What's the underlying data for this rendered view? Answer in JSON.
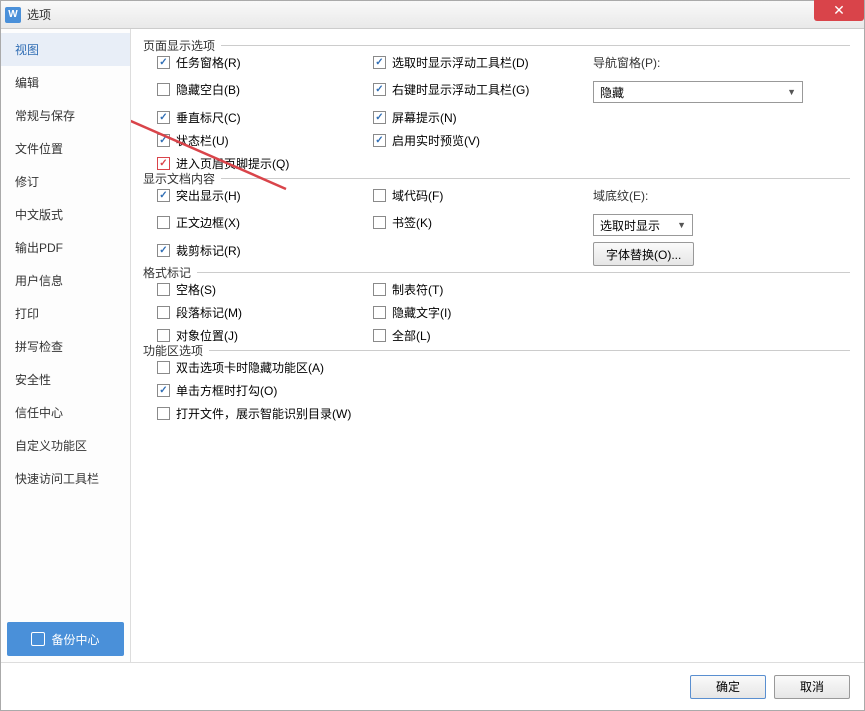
{
  "window": {
    "app_icon_letter": "W",
    "title": "选项",
    "close_glyph": "✕"
  },
  "sidebar": {
    "items": [
      {
        "label": "视图",
        "selected": true
      },
      {
        "label": "编辑"
      },
      {
        "label": "常规与保存"
      },
      {
        "label": "文件位置"
      },
      {
        "label": "修订"
      },
      {
        "label": "中文版式"
      },
      {
        "label": "输出PDF"
      },
      {
        "label": "用户信息"
      },
      {
        "label": "打印"
      },
      {
        "label": "拼写检查"
      },
      {
        "label": "安全性"
      },
      {
        "label": "信任中心"
      },
      {
        "label": "自定义功能区"
      },
      {
        "label": "快速访问工具栏"
      }
    ],
    "backup_label": "备份中心"
  },
  "sections": {
    "page_display": {
      "legend": "页面显示选项",
      "col1": [
        {
          "label": "任务窗格(R)",
          "checked": true
        },
        {
          "label": "隐藏空白(B)",
          "checked": false
        },
        {
          "label": "垂直标尺(C)",
          "checked": true
        },
        {
          "label": "状态栏(U)",
          "checked": true
        },
        {
          "label": "进入页眉页脚提示(Q)",
          "checked": true,
          "red": true
        }
      ],
      "col2": [
        {
          "label": "选取时显示浮动工具栏(D)",
          "checked": true
        },
        {
          "label": "右键时显示浮动工具栏(G)",
          "checked": true
        },
        {
          "label": "屏幕提示(N)",
          "checked": true
        },
        {
          "label": "启用实时预览(V)",
          "checked": true
        }
      ],
      "col3": {
        "nav_label": "导航窗格(P):",
        "nav_value": "隐藏"
      }
    },
    "doc_content": {
      "legend": "显示文档内容",
      "col1": [
        {
          "label": "突出显示(H)",
          "checked": true
        },
        {
          "label": "正文边框(X)",
          "checked": false
        },
        {
          "label": "裁剪标记(R)",
          "checked": true
        }
      ],
      "col2": [
        {
          "label": "域代码(F)",
          "checked": false
        },
        {
          "label": "书签(K)",
          "checked": false
        }
      ],
      "col3": {
        "shading_label": "域底纹(E):",
        "shading_value": "选取时显示",
        "font_btn": "字体替换(O)..."
      }
    },
    "format_marks": {
      "legend": "格式标记",
      "col1": [
        {
          "label": "空格(S)",
          "checked": false
        },
        {
          "label": "段落标记(M)",
          "checked": false
        },
        {
          "label": "对象位置(J)",
          "checked": false
        }
      ],
      "col2": [
        {
          "label": "制表符(T)",
          "checked": false
        },
        {
          "label": "隐藏文字(I)",
          "checked": false
        },
        {
          "label": "全部(L)",
          "checked": false
        }
      ]
    },
    "ribbon": {
      "legend": "功能区选项",
      "items": [
        {
          "label": "双击选项卡时隐藏功能区(A)",
          "checked": false
        },
        {
          "label": "单击方框时打勾(O)",
          "checked": true
        },
        {
          "label": "打开文件，展示智能识别目录(W)",
          "checked": false
        }
      ]
    }
  },
  "footer": {
    "ok": "确定",
    "cancel": "取消"
  }
}
